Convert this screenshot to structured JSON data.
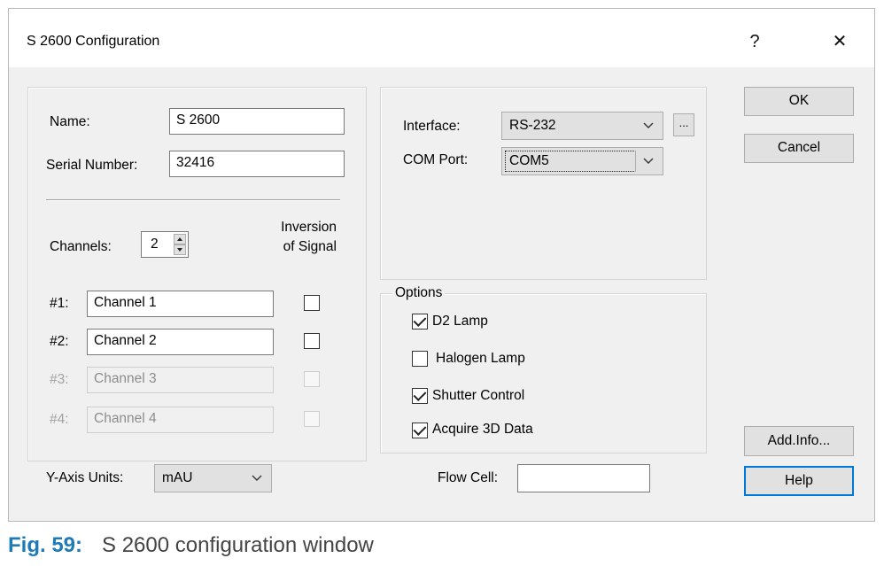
{
  "window": {
    "title": "S 2600 Configuration",
    "help_glyph": "?",
    "close_glyph": "✕"
  },
  "general": {
    "name_label": "Name:",
    "name_value": "S 2600",
    "serial_label": "Serial Number:",
    "serial_value": "32416",
    "channels_label": "Channels:",
    "channels_value": "2",
    "inversion_label_1": "Inversion",
    "inversion_label_2": "of Signal"
  },
  "channels": [
    {
      "label": "#1:",
      "value": "Channel 1",
      "enabled": true,
      "inverted": false
    },
    {
      "label": "#2:",
      "value": "Channel 2",
      "enabled": true,
      "inverted": false
    },
    {
      "label": "#3:",
      "value": "Channel 3",
      "enabled": false,
      "inverted": false
    },
    {
      "label": "#4:",
      "value": "Channel 4",
      "enabled": false,
      "inverted": false
    }
  ],
  "yaxis": {
    "label": "Y-Axis Units:",
    "value": "mAU"
  },
  "interface": {
    "interface_label": "Interface:",
    "interface_value": "RS-232",
    "browse_label": "...",
    "com_label": "COM Port:",
    "com_value": "COM5"
  },
  "options": {
    "title": "Options",
    "items": [
      {
        "label": "D2 Lamp",
        "checked": true
      },
      {
        "label": "Halogen Lamp",
        "checked": false
      },
      {
        "label": "Shutter Control",
        "checked": true
      },
      {
        "label": "Acquire 3D Data",
        "checked": true
      }
    ]
  },
  "flowcell": {
    "label": "Flow Cell:",
    "value": ""
  },
  "buttons": {
    "ok": "OK",
    "cancel": "Cancel",
    "addinfo": "Add.Info...",
    "help": "Help"
  },
  "caption": {
    "number": "Fig. 59:",
    "text": "S 2600 configuration window"
  },
  "colors": {
    "accent": "#0078d7",
    "caption_number": "#1f7ab8"
  }
}
